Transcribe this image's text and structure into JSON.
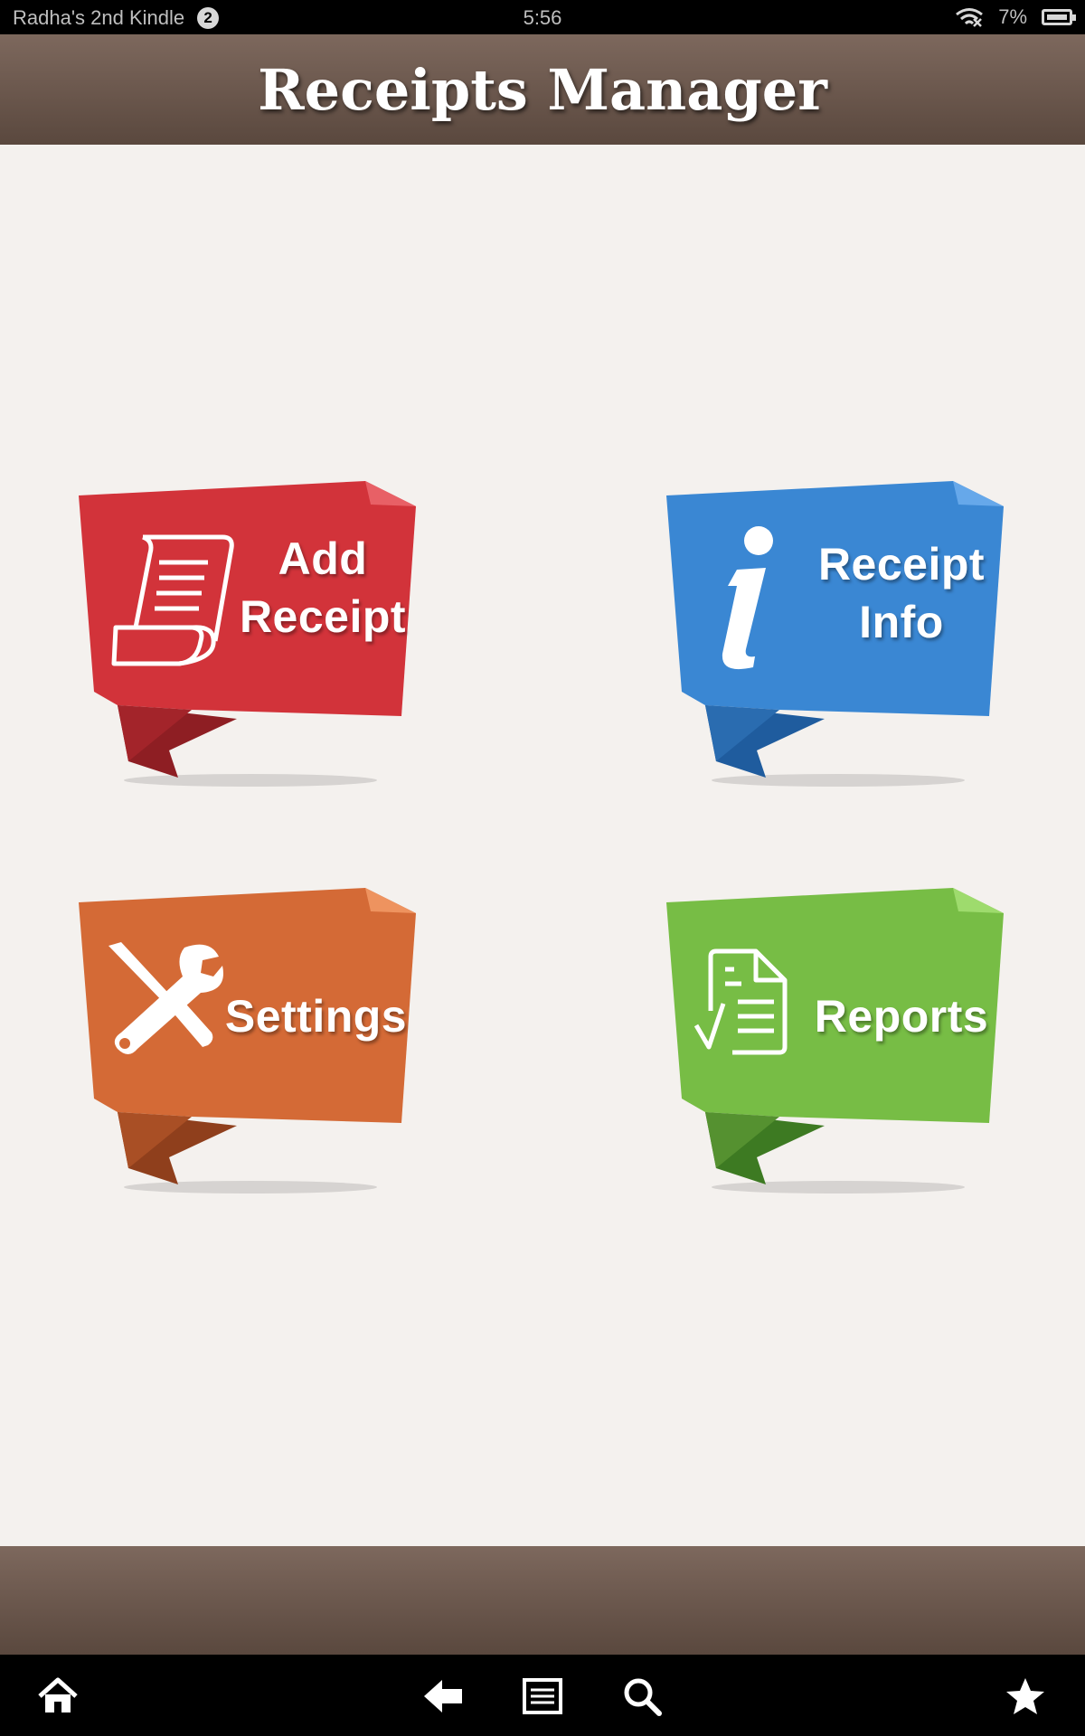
{
  "status_bar": {
    "device_name": "Radha's 2nd Kindle",
    "notification_count": "2",
    "time": "5:56",
    "battery_percent": "7%",
    "icons": [
      "wifi-icon",
      "battery-icon"
    ]
  },
  "header": {
    "title": "Receipts Manager"
  },
  "tiles": [
    {
      "line1": "Add",
      "line2": "Receipt",
      "icon": "scroll-receipt-icon",
      "color": "#d2333a"
    },
    {
      "line1": "Receipt",
      "line2": "Info",
      "icon": "info-icon",
      "color": "#3a87d3"
    },
    {
      "line1": "Settings",
      "icon": "tools-icon",
      "color": "#d46a36"
    },
    {
      "line1": "Reports",
      "icon": "report-checklist-icon",
      "color": "#77bd45"
    }
  ],
  "nav_bar": {
    "buttons": [
      "home-icon",
      "back-icon",
      "menu-icon",
      "search-icon",
      "favorites-star-icon"
    ]
  }
}
